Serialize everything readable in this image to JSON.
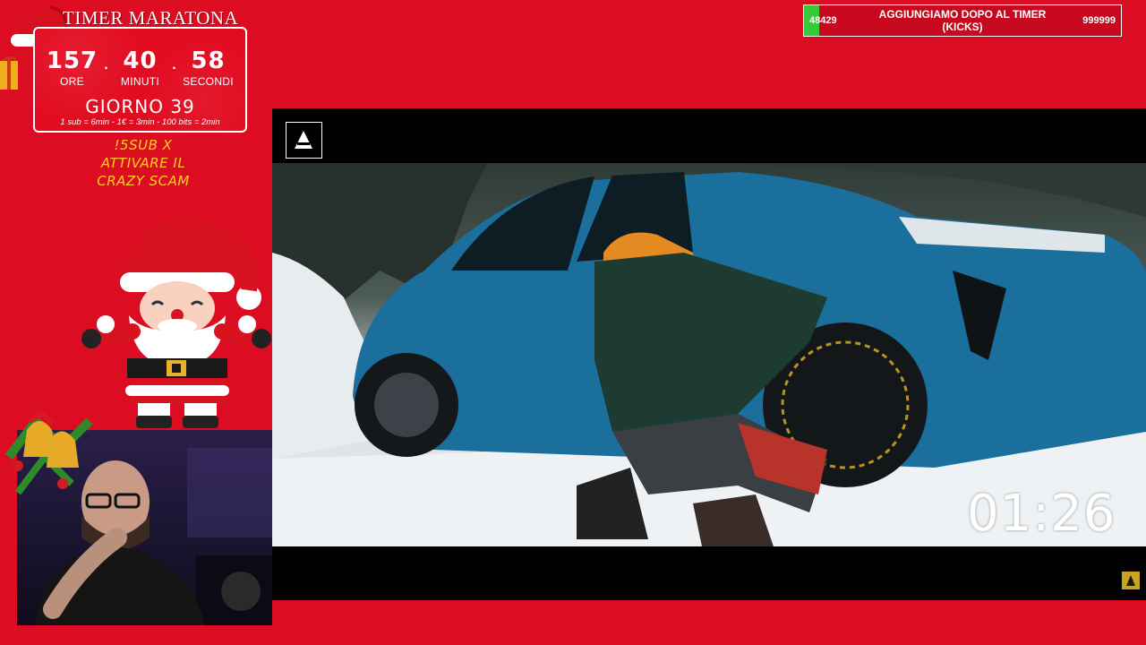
{
  "timer": {
    "title": "TIMER MARATONA",
    "hours": "157",
    "minutes": "40",
    "seconds": "58",
    "hours_label": "ORE",
    "minutes_label": "MINUTI",
    "seconds_label": "SECONDI",
    "day": "GIORNO 39",
    "rates": "1 sub = 6min - 1€ = 3min - 100 bits = 2min"
  },
  "promo": {
    "line1": "!5SUB X",
    "line2": "ATTIVARE IL",
    "line3": "CRAZY SCAM"
  },
  "goal": {
    "current": "48429",
    "label": "AGGIUNGIAMO DOPO AL TIMER (KICKS)",
    "target": "999999",
    "progress_fraction": 0.048,
    "fill_color": "#38c93a"
  },
  "video": {
    "countdown": "01:26"
  },
  "colors": {
    "background": "#dc0d23",
    "promo_text": "#ffd21a",
    "logo_gold": "#c9a421",
    "car_blue": "#1b6f9c"
  },
  "icons": {
    "santa": "santa-claus-illustration",
    "hat": "santa-hat-icon",
    "bells": "christmas-bells-icon",
    "gift": "gift-icon",
    "channel_logo": "a-logo-icon"
  }
}
